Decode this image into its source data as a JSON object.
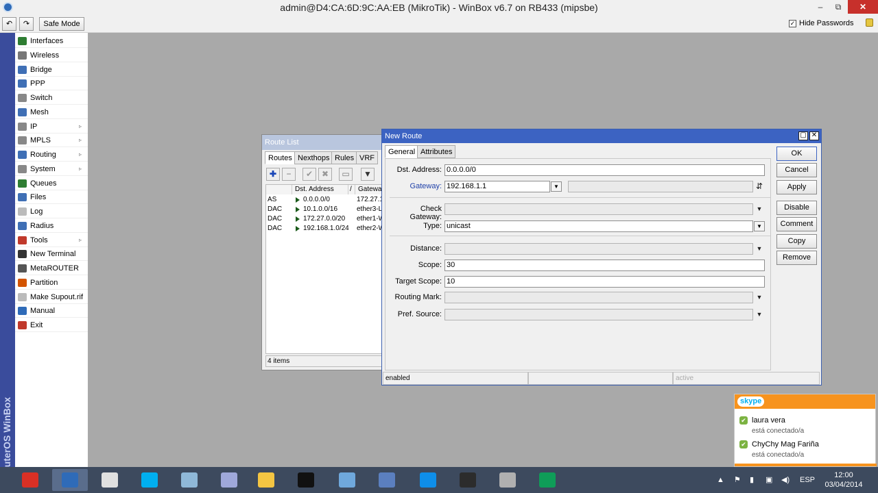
{
  "window": {
    "title": "admin@D4:CA:6D:9C:AA:EB (MikroTik) - WinBox v6.7 on RB433 (mipsbe)",
    "minimize_glyph": "–",
    "maximize_glyph": "⧉",
    "close_glyph": "✕"
  },
  "toolbar": {
    "undo_glyph": "↶",
    "redo_glyph": "↷",
    "safe_mode": "Safe Mode",
    "hide_passwords": "Hide Passwords",
    "hide_passwords_checked": "✓"
  },
  "brand": "RouterOS WinBox",
  "sidebar": {
    "submenu_arrow": "▹",
    "items": [
      {
        "label": "Interfaces",
        "icon": "interfaces-icon",
        "color": "#2e7d32"
      },
      {
        "label": "Wireless",
        "icon": "wireless-icon",
        "color": "#777777"
      },
      {
        "label": "Bridge",
        "icon": "bridge-icon",
        "color": "#3f6fb5"
      },
      {
        "label": "PPP",
        "icon": "ppp-icon",
        "color": "#3f6fb5"
      },
      {
        "label": "Switch",
        "icon": "switch-icon",
        "color": "#888888"
      },
      {
        "label": "Mesh",
        "icon": "mesh-icon",
        "color": "#3f6fb5"
      },
      {
        "label": "IP",
        "icon": "ip-icon",
        "color": "#888888"
      },
      {
        "label": "MPLS",
        "icon": "mpls-icon",
        "color": "#888888"
      },
      {
        "label": "Routing",
        "icon": "routing-icon",
        "color": "#3f6fb5"
      },
      {
        "label": "System",
        "icon": "system-icon",
        "color": "#888888"
      },
      {
        "label": "Queues",
        "icon": "queues-icon",
        "color": "#2e7d32"
      },
      {
        "label": "Files",
        "icon": "files-icon",
        "color": "#3f6fb5"
      },
      {
        "label": "Log",
        "icon": "log-icon",
        "color": "#bbbbbb"
      },
      {
        "label": "Radius",
        "icon": "radius-icon",
        "color": "#3f6fb5"
      },
      {
        "label": "Tools",
        "icon": "tools-icon",
        "color": "#c0392b"
      },
      {
        "label": "New Terminal",
        "icon": "terminal-icon",
        "color": "#333333"
      },
      {
        "label": "MetaROUTER",
        "icon": "metarouter-icon",
        "color": "#555555"
      },
      {
        "label": "Partition",
        "icon": "partition-icon",
        "color": "#d35400"
      },
      {
        "label": "Make Supout.rif",
        "icon": "supout-icon",
        "color": "#bbbbbb"
      },
      {
        "label": "Manual",
        "icon": "manual-icon",
        "color": "#2f6bb8"
      },
      {
        "label": "Exit",
        "icon": "exit-icon",
        "color": "#c0392b"
      }
    ]
  },
  "route_list": {
    "title": "Route List",
    "tabs": [
      "Routes",
      "Nexthops",
      "Rules",
      "VRF"
    ],
    "tools": {
      "add": "✚",
      "remove": "−",
      "enable": "✔",
      "disable": "✖",
      "comment": "▭",
      "filter": "▼"
    },
    "columns": [
      "Dst. Address",
      "/",
      "Gateway"
    ],
    "rows": [
      {
        "flags": "AS",
        "dst": "0.0.0.0/0",
        "gateway": "172.27.1"
      },
      {
        "flags": "DAC",
        "dst": "10.1.0.0/16",
        "gateway": "ether3-L"
      },
      {
        "flags": "DAC",
        "dst": "172.27.0.0/20",
        "gateway": "ether1-W"
      },
      {
        "flags": "DAC",
        "dst": "192.168.1.0/24",
        "gateway": "ether2-W"
      }
    ],
    "status": "4 items"
  },
  "new_route": {
    "title": "New Route",
    "tabs": [
      "General",
      "Attributes"
    ],
    "arrow_down": "▼",
    "arrow_updown": "⇵",
    "fields": {
      "dst_address": {
        "label": "Dst. Address:",
        "value": "0.0.0.0/0"
      },
      "gateway": {
        "label": "Gateway:",
        "value": "192.168.1.1"
      },
      "check_gateway": {
        "label": "Check Gateway:",
        "value": ""
      },
      "type": {
        "label": "Type:",
        "value": "unicast"
      },
      "distance": {
        "label": "Distance:",
        "value": ""
      },
      "scope": {
        "label": "Scope:",
        "value": "30"
      },
      "target_scope": {
        "label": "Target Scope:",
        "value": "10"
      },
      "routing_mark": {
        "label": "Routing Mark:",
        "value": ""
      },
      "pref_source": {
        "label": "Pref. Source:",
        "value": ""
      }
    },
    "buttons": {
      "ok": "OK",
      "cancel": "Cancel",
      "apply": "Apply",
      "disable": "Disable",
      "comment": "Comment",
      "copy": "Copy",
      "remove": "Remove"
    },
    "status": {
      "left": "enabled",
      "middle": "",
      "right": "active"
    }
  },
  "skype": {
    "logo": "skype",
    "contacts": [
      {
        "name": "laura vera",
        "status": "está conectado/a"
      },
      {
        "name": "ChyChy Mag Fariña",
        "status": "está conectado/a"
      }
    ],
    "online_glyph": "✔"
  },
  "taskbar": {
    "apps": [
      {
        "name": "chrome",
        "color": "#d93025"
      },
      {
        "name": "winbox",
        "color": "#2f6bb8"
      },
      {
        "name": "start-screen",
        "color": "#e0e0e0"
      },
      {
        "name": "skype",
        "color": "#00aff0"
      },
      {
        "name": "edit",
        "color": "#8fb8d8"
      },
      {
        "name": "virtualbox",
        "color": "#9fa8da"
      },
      {
        "name": "explorer",
        "color": "#f4c542"
      },
      {
        "name": "cmd",
        "color": "#111111"
      },
      {
        "name": "network",
        "color": "#6fa8dc"
      },
      {
        "name": "remote",
        "color": "#5b7fbf"
      },
      {
        "name": "teamviewer",
        "color": "#0e8ee9"
      },
      {
        "name": "mikrotik",
        "color": "#2c2c2c"
      },
      {
        "name": "tool",
        "color": "#b0b0b0"
      },
      {
        "name": "hangouts",
        "color": "#0f9d58"
      }
    ],
    "lang": "ESP",
    "time": "12:00",
    "date": "03/04/2014"
  }
}
